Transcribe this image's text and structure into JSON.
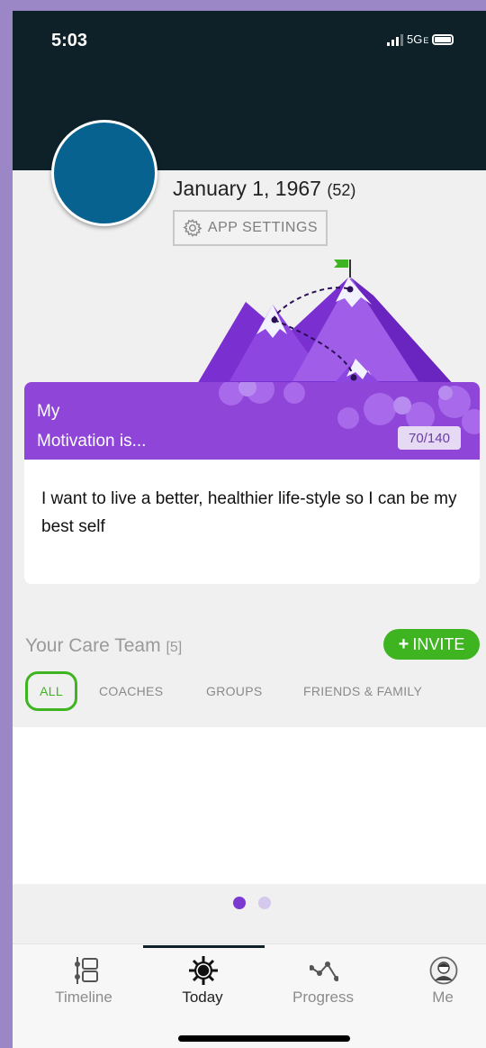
{
  "status_bar": {
    "time": "5:03",
    "network": "5G",
    "network_suffix": "E",
    "battery_icon": "battery-icon",
    "signal_icon": "signal-icon"
  },
  "profile": {
    "avatar_color": "#07628f",
    "dob": "January 1, 1967",
    "age": "(52)",
    "settings_label": "APP SETTINGS",
    "settings_icon": "gear-icon"
  },
  "motivation": {
    "title_line1": "My",
    "title_line2": "Motivation is...",
    "counter": "70/140",
    "text": "I want to live a better, healthier life-style so I can be my best self",
    "accent": "#8e45d8"
  },
  "care_team": {
    "title": "Your Care Team",
    "count": "[5]",
    "invite_label": "INVITE",
    "invite_icon": "plus-icon",
    "tabs": [
      "ALL",
      "COACHES",
      "GROUPS",
      "FRIENDS & FAMILY"
    ],
    "selected_tab": "ALL",
    "accent": "#3fb421"
  },
  "pager": {
    "pages": 2,
    "current": 1
  },
  "tab_bar": {
    "items": [
      {
        "label": "Timeline",
        "icon": "timeline-icon"
      },
      {
        "label": "Today",
        "icon": "sun-icon"
      },
      {
        "label": "Progress",
        "icon": "progress-icon"
      },
      {
        "label": "Me",
        "icon": "user-icon"
      }
    ],
    "selected": "Today"
  }
}
